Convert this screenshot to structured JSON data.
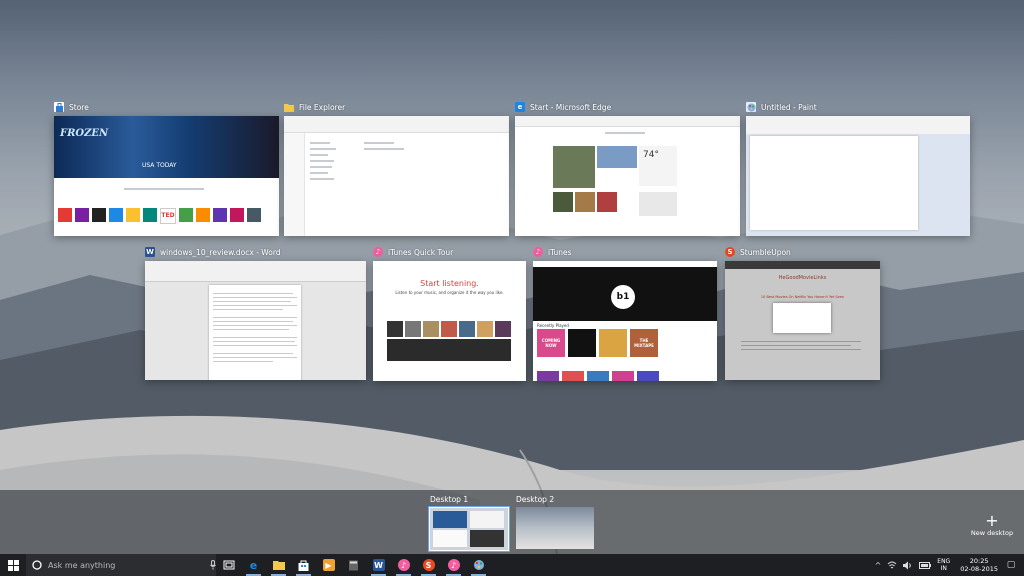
{
  "windows": [
    {
      "title": "Store",
      "icon": "store-icon",
      "color": "#2d7dd2"
    },
    {
      "title": "File Explorer",
      "icon": "folder-icon",
      "color": "#f2c94c"
    },
    {
      "title": "Start - Microsoft Edge",
      "icon": "edge-icon",
      "color": "#1e88e5"
    },
    {
      "title": "Untitled - Paint",
      "icon": "paint-icon",
      "color": "#f2f2f2"
    },
    {
      "title": "windows_10_review.docx - Word",
      "icon": "word-icon",
      "color": "#2b579a"
    },
    {
      "title": "iTunes Quick Tour",
      "icon": "itunes-icon",
      "color": "#f25fa0"
    },
    {
      "title": "iTunes",
      "icon": "itunes-icon",
      "color": "#f25fa0"
    },
    {
      "title": "StumbleUpon",
      "icon": "stumbleupon-icon",
      "color": "#eb4924"
    }
  ],
  "previews": {
    "store": {
      "hero_title": "FROZEN",
      "hero_caption": "USA TODAY",
      "tile_label": "TED"
    },
    "tour": {
      "headline": "Start listening.",
      "subline": "Listen to your music, and organize it the way you like."
    },
    "itunes": {
      "beats_label": "1",
      "section_1": "Recently Played",
      "tile_1": "COMING NOW",
      "tile_2": "THE MIXTAPE"
    },
    "stumble": {
      "logo_text": "HeGoodMovieLinks",
      "heading": "10 Best Movies On Netflix You Haven't Yet Seen"
    },
    "edge": {
      "weather": "74°"
    }
  },
  "desktops": [
    {
      "label": "Desktop 1",
      "active": true
    },
    {
      "label": "Desktop 2",
      "active": false
    }
  ],
  "new_desktop": {
    "label": "New desktop"
  },
  "taskbar": {
    "search_placeholder": "Ask me anything",
    "apps": [
      {
        "name": "edge",
        "glyph": "e",
        "color": "#1e88e5",
        "running": true
      },
      {
        "name": "file-explorer",
        "glyph": "",
        "color": "#f2c94c",
        "running": true
      },
      {
        "name": "store",
        "glyph": "",
        "color": "#ffffff",
        "running": true
      },
      {
        "name": "media",
        "glyph": "▶",
        "color": "#f0a030",
        "running": false
      },
      {
        "name": "calculator",
        "glyph": "",
        "color": "#555555",
        "running": false
      },
      {
        "name": "word",
        "glyph": "W",
        "color": "#2b579a",
        "running": true
      },
      {
        "name": "itunes",
        "glyph": "♪",
        "color": "#f25fa0",
        "running": true
      },
      {
        "name": "stumbleupon",
        "glyph": "S",
        "color": "#eb4924",
        "running": true
      },
      {
        "name": "itunes-2",
        "glyph": "♪",
        "color": "#f25fa0",
        "running": true
      },
      {
        "name": "paint",
        "glyph": "",
        "color": "#7fb3e6",
        "running": true
      }
    ],
    "tray": {
      "lang_1": "ENG",
      "lang_2": "IN",
      "time": "20:25",
      "date": "02-08-2015"
    }
  }
}
